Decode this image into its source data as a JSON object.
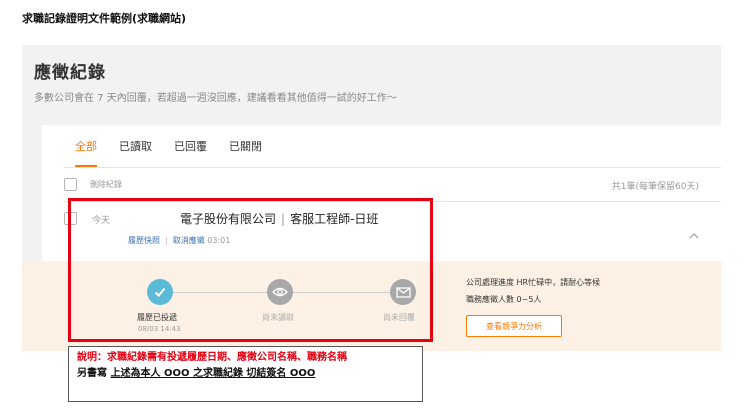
{
  "doc_title": "求職記錄證明文件範例(求職網站)",
  "panel": {
    "title": "應徵紀錄",
    "subtitle": "多數公司會在 7 天內回覆，若超過一週沒回應，建議看看其他值得一試的好工作～"
  },
  "tabs": [
    {
      "label": "全部",
      "active": true
    },
    {
      "label": "已讀取",
      "active": false
    },
    {
      "label": "已回覆",
      "active": false
    },
    {
      "label": "已關閉",
      "active": false
    }
  ],
  "list_header": {
    "delete_label": "刪除紀錄",
    "count_text": "共1筆(每筆保留60天)"
  },
  "record": {
    "date": "今天",
    "company": "電子股份有限公司",
    "separator": "|",
    "job_title": "客服工程師-日班",
    "link_resume": "履歷快照",
    "link_cancel": "取消應徵",
    "cancel_time": "03:01"
  },
  "progress": {
    "steps": [
      {
        "label": "履歷已投遞",
        "time": "08/03 14:43",
        "done": true
      },
      {
        "label": "尚未讀取",
        "time": "",
        "done": false
      },
      {
        "label": "尚未回覆",
        "time": "",
        "done": false
      }
    ],
    "status_line1": "公司處理進度 HR忙碌中，請耐心等候",
    "status_line2": "職務應徵人數 0~5人",
    "analysis_button": "查看競爭力分析"
  },
  "note": {
    "line1": "說明：求職紀錄需有投遞履歷日期、應徵公司名稱、職務名稱",
    "line2_prefix": "另書寫",
    "line2_underlined": "上述為本人 OOO 之求職紀錄 切結簽名 OOO"
  },
  "colors": {
    "accent": "#ff7800",
    "link": "#3b6fb6",
    "done_step": "#5bbad5",
    "pending_step": "#a8a8a8",
    "highlight": "#e60012"
  }
}
